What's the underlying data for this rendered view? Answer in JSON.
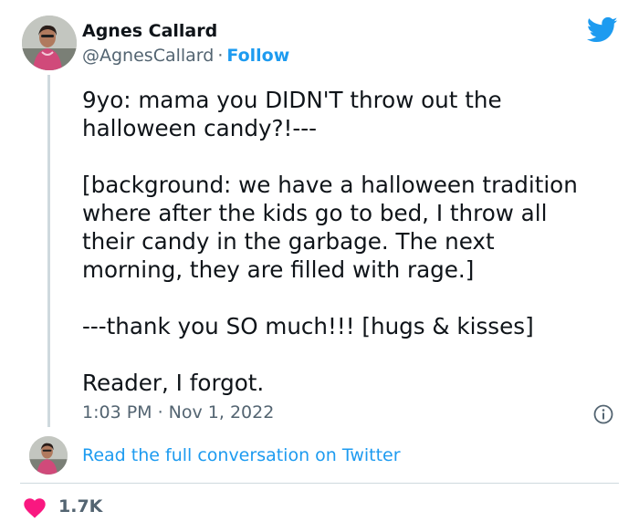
{
  "author": {
    "name": "Agnes Callard",
    "handle": "@AgnesCallard",
    "separator": "·",
    "follow_label": "Follow"
  },
  "tweet": {
    "lines": [
      "9yo: mama you DIDN'T throw out the",
      "halloween candy?!---",
      "[background: we have a halloween tradition",
      "where after the kids go to bed, I throw all",
      "their candy in the garbage.  The next",
      "morning, they are filled with rage.]",
      "---thank you SO much!!! [hugs & kisses]",
      "Reader, I forgot."
    ]
  },
  "meta": {
    "timestamp": "1:03 PM · Nov 1, 2022"
  },
  "footer": {
    "read_link": "Read the full conversation on Twitter",
    "like_count": "1.7K"
  },
  "icons": {
    "brand": "twitter-bird-icon",
    "info": "info-icon",
    "like": "heart-icon"
  },
  "colors": {
    "brand_blue": "#1d9bf0",
    "like_red": "#f91880",
    "secondary_text": "#536471",
    "primary_text": "#0f1419"
  }
}
